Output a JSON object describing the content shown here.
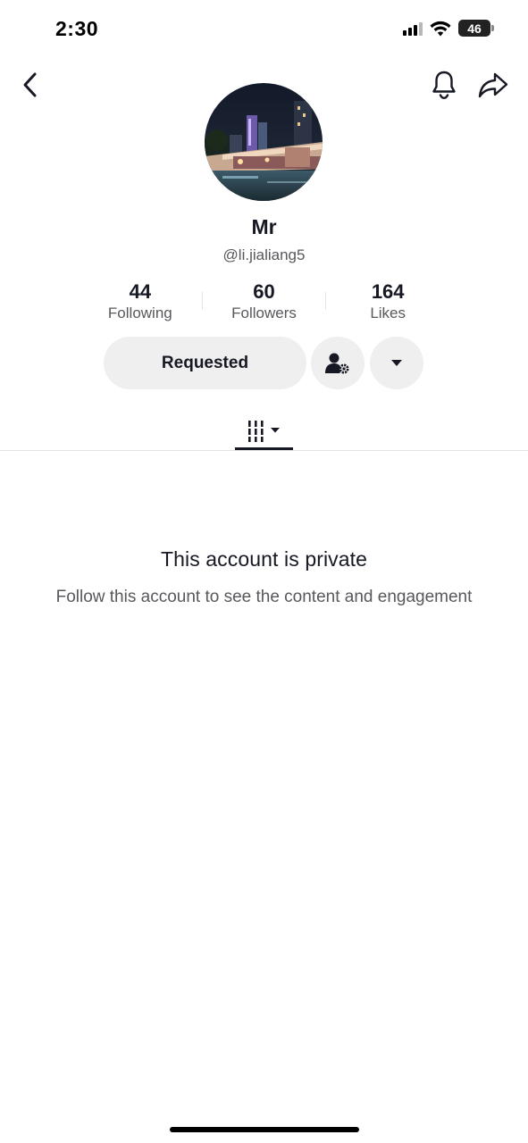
{
  "status_bar": {
    "time": "2:30",
    "battery_level": "46",
    "icons": [
      "cellular-signal-icon",
      "wifi-icon",
      "battery-icon"
    ]
  },
  "nav": {
    "icons": [
      "back-chevron-icon",
      "bell-icon",
      "share-arrow-icon"
    ]
  },
  "profile": {
    "display_name": "Mr",
    "username": "@li.jialiang5"
  },
  "stats": [
    {
      "value": "44",
      "label": "Following"
    },
    {
      "value": "60",
      "label": "Followers"
    },
    {
      "value": "164",
      "label": "Likes"
    }
  ],
  "actions": {
    "requested_label": "Requested",
    "icons": [
      "user-settings-icon",
      "caret-down-icon"
    ]
  },
  "tabs": {
    "active_icon": "grid-videos-icon"
  },
  "private": {
    "title": "This account is private",
    "subtitle": "Follow this account to see the content and engagement"
  },
  "colors": {
    "text_primary": "#161823",
    "text_secondary": "#57585c",
    "button_bg": "#efefef",
    "divider": "#e3e3e4"
  }
}
